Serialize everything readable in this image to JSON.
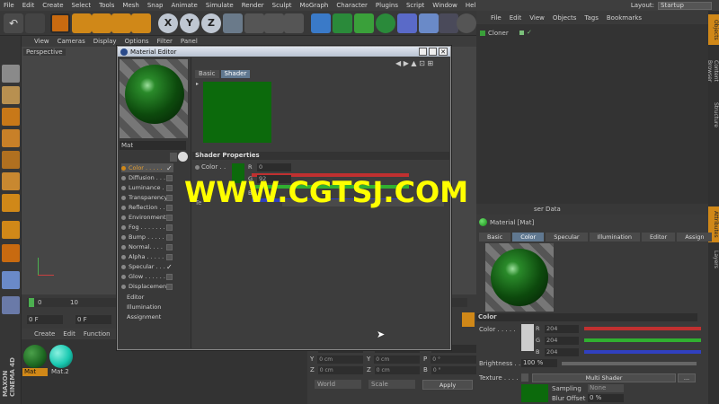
{
  "menu": [
    "File",
    "Edit",
    "Create",
    "Select",
    "Tools",
    "Mesh",
    "Snap",
    "Animate",
    "Simulate",
    "Render",
    "Sculpt",
    "MoGraph",
    "Character",
    "Plugins",
    "Script",
    "Window",
    "Help"
  ],
  "layout": {
    "label": "Layout:",
    "value": "Startup"
  },
  "toolbar": {
    "x": "X",
    "y": "Y",
    "z": "Z"
  },
  "viewport": {
    "menu": [
      "View",
      "Cameras",
      "Display",
      "Options",
      "Filter",
      "Panel"
    ],
    "label": "Perspective"
  },
  "timeline": {
    "tick0": "0",
    "tick10": "10",
    "frame": "0 F",
    "frame2": "0 F"
  },
  "materials": {
    "menu": [
      "Create",
      "Edit",
      "Function",
      "Te"
    ],
    "items": [
      {
        "label": "Mat",
        "color": "#1f6b23"
      },
      {
        "label": "Mat.2",
        "color": "#18c8b0"
      }
    ],
    "logo_line1": "MAXON",
    "logo_line2": "CINEMA 4D"
  },
  "coords": {
    "rows": [
      [
        "X",
        "0 cm",
        "X",
        "0 cm",
        "H",
        "0 °"
      ],
      [
        "Y",
        "0 cm",
        "Y",
        "0 cm",
        "P",
        "0 °"
      ],
      [
        "Z",
        "0 cm",
        "Z",
        "0 cm",
        "B",
        "0 °"
      ]
    ],
    "mode1": "World",
    "mode2": "Scale",
    "apply": "Apply"
  },
  "objects": {
    "menu": [
      "File",
      "Edit",
      "View",
      "Objects",
      "Tags",
      "Bookmarks"
    ],
    "item": "Cloner"
  },
  "side_tabs": {
    "top": [
      "Objects",
      "Content Browser",
      "Structure"
    ],
    "bottom": [
      "Attributes",
      "Layers"
    ]
  },
  "attributes": {
    "header": "ser Data",
    "title": "Material [Mat]",
    "tabs": [
      "Basic",
      "Color",
      "Specular",
      "Illumination",
      "Editor",
      "Assign"
    ],
    "active_tab": "Color",
    "section": "Color",
    "color_label": "Color . . . . .",
    "r": "204",
    "g": "204",
    "b": "204",
    "brightness_label": "Brightness . .",
    "brightness": "100 %",
    "texture_label": "Texture . . . .",
    "texture_value": "Multi Shader",
    "sampling_label": "Sampling",
    "sampling": "None",
    "blur_label": "Blur Offset",
    "blur": "0 %",
    "dots": "..."
  },
  "editor": {
    "title": "Material Editor",
    "name": "Mat",
    "tabs": [
      "Basic",
      "Shader"
    ],
    "active_tab": "Shader",
    "shader_props": "Shader Properties",
    "color_label": "Color . .",
    "r_label": "R",
    "r": "0",
    "g_label": "G",
    "g": "92",
    "b_label": "B",
    "hidden_label": "Te",
    "swatch": "#0c6a0c",
    "channels": [
      {
        "label": "Color . . . . .",
        "check": "✓"
      },
      {
        "label": "Diffusion . . .",
        "check": ""
      },
      {
        "label": "Luminance . .",
        "check": ""
      },
      {
        "label": "Transparency",
        "check": ""
      },
      {
        "label": "Reflection . .",
        "check": ""
      },
      {
        "label": "Environment",
        "check": ""
      },
      {
        "label": "Fog . . . . . . .",
        "check": ""
      },
      {
        "label": "Bump . . . . .",
        "check": ""
      },
      {
        "label": "Normal. . . .",
        "check": ""
      },
      {
        "label": "Alpha . . . . .",
        "check": ""
      },
      {
        "label": "Specular . . .",
        "check": "✓"
      },
      {
        "label": "Glow . . . . . .",
        "check": ""
      },
      {
        "label": "Displacement",
        "check": ""
      }
    ],
    "extra": [
      "Editor",
      "Illumination",
      "Assignment"
    ]
  },
  "watermark": "WWW.CGTSJ.COM",
  "colors": {
    "accent": "#607890",
    "green": "#0c6a0c",
    "watermark": "#ffff00"
  }
}
